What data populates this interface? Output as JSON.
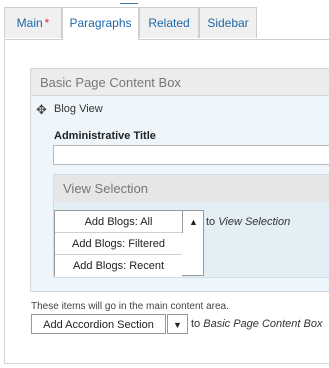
{
  "tabs": [
    {
      "label": "Main",
      "required_marker": "*"
    },
    {
      "label": "Paragraphs"
    },
    {
      "label": "Related"
    },
    {
      "label": "Sidebar"
    }
  ],
  "content_box": {
    "title": "Basic Page Content Box",
    "item_title": "Blog View",
    "admin_title_label": "Administrative Title",
    "admin_title_value": "",
    "view_selection": {
      "title": "View Selection",
      "options": [
        "Add Blogs: All",
        "Add Blogs: Filtered",
        "Add Blogs: Recent"
      ],
      "to_prefix": "to",
      "to_target": "View Selection"
    }
  },
  "footer": {
    "hint": "These items will go in the main content area.",
    "add_button": "Add Accordion Section",
    "to_prefix": "to",
    "to_target": "Basic Page Content Box"
  },
  "colors": {
    "tab_link": "#1f66a8",
    "required": "#d6312f",
    "box_bg": "#eef6fb"
  }
}
